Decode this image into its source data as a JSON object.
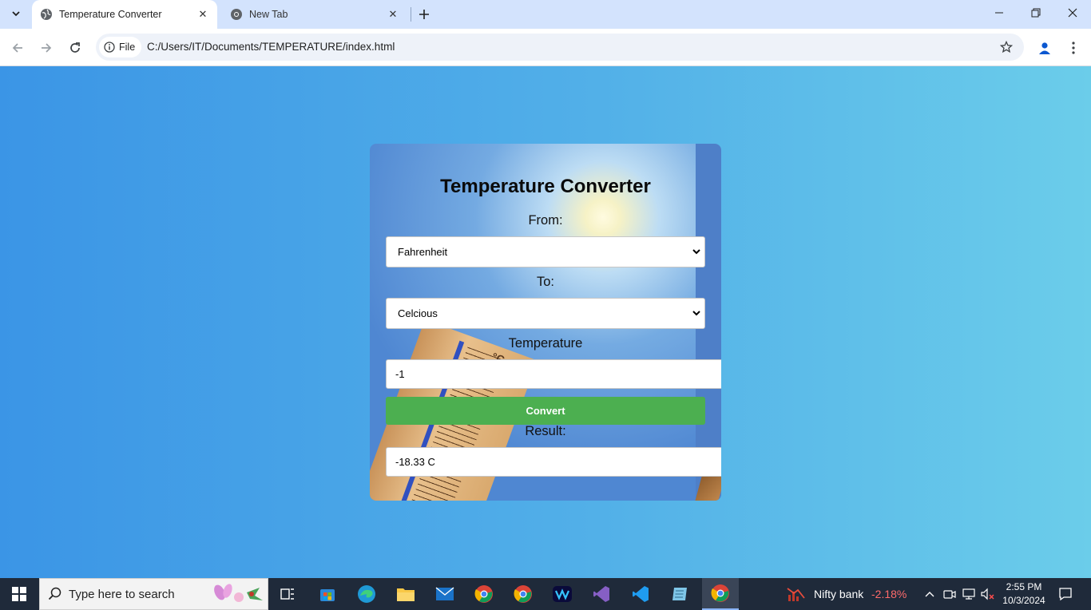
{
  "browser": {
    "tabs": [
      {
        "title": "Temperature Converter",
        "active": true
      },
      {
        "title": "New Tab",
        "active": false
      }
    ],
    "address": {
      "site_label": "File",
      "url": "C:/Users/IT/Documents/TEMPERATURE/index.html"
    }
  },
  "app": {
    "title": "Temperature Converter",
    "from_label": "From:",
    "from_value": "Fahrenheit",
    "to_label": "To:",
    "to_value": "Celcious",
    "temperature_label": "Temperature",
    "temperature_value": "-1",
    "convert_label": "Convert",
    "result_label": "Result:",
    "result_value": "-18.33 C",
    "convert_color": "#4caf50"
  },
  "taskbar": {
    "search_placeholder": "Type here to search",
    "widget_name": "Nifty bank",
    "widget_change": "-2.18%",
    "time": "2:55 PM",
    "date": "10/3/2024"
  }
}
